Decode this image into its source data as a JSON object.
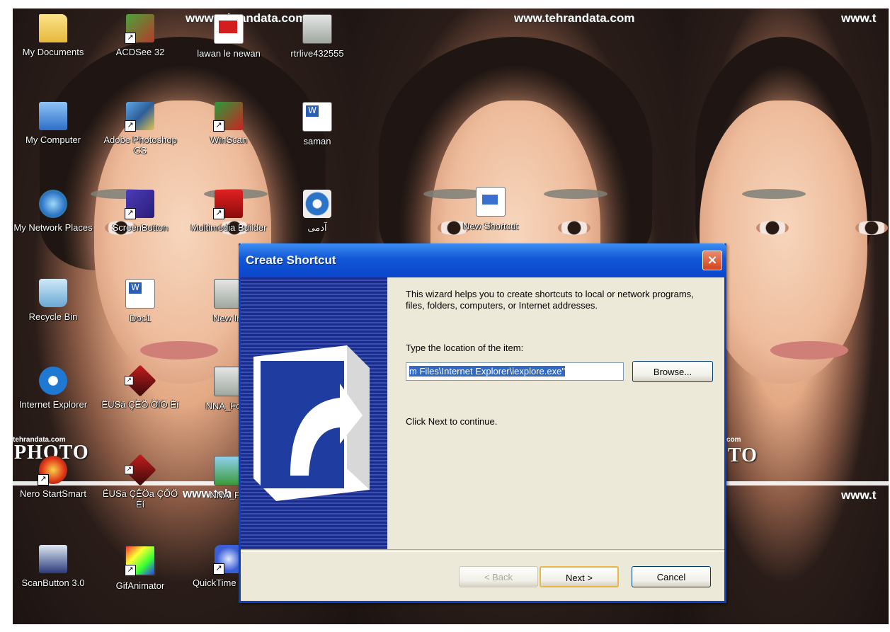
{
  "wallpaper": {
    "urls": [
      "www.tehrandata.com",
      "www.tehrandata.com",
      "www.t",
      "www.teh",
      "www.t"
    ],
    "site_label": "tehrandata.com",
    "photo_text": "PHOTO",
    "photo_text_right": "TO",
    "site_label_right": "com"
  },
  "desktop_icons": [
    {
      "id": "my-documents",
      "label": "My Documents",
      "icon": "folder-icon"
    },
    {
      "id": "acdsee",
      "label": "ACDSee 32",
      "icon": "acdsee-icon"
    },
    {
      "id": "lawan",
      "label": "lawan le newan",
      "icon": "pdf-icon"
    },
    {
      "id": "rtrlive",
      "label": "rtrlive432555",
      "icon": "image-file-icon"
    },
    {
      "id": "my-computer",
      "label": "My Computer",
      "icon": "computer-icon"
    },
    {
      "id": "photoshop",
      "label": "Adobe Photoshop CS",
      "icon": "photoshop-icon"
    },
    {
      "id": "winscan",
      "label": "WinScan",
      "icon": "scanner-icon"
    },
    {
      "id": "saman",
      "label": "saman",
      "icon": "word-doc-icon"
    },
    {
      "id": "my-network",
      "label": "My Network Places",
      "icon": "network-icon"
    },
    {
      "id": "screenbutton",
      "label": "ScreenButton",
      "icon": "app-icon"
    },
    {
      "id": "multimedia",
      "label": "Multimedia Builder",
      "icon": "multimedia-icon"
    },
    {
      "id": "adamy",
      "label": "آدمی",
      "icon": "media-player-icon"
    },
    {
      "id": "recycle-bin",
      "label": "Recycle Bin",
      "icon": "recycle-bin-icon"
    },
    {
      "id": "doc1",
      "label": "Doc1",
      "icon": "word-doc-icon"
    },
    {
      "id": "new-image",
      "label": "New Im",
      "icon": "image-file-icon"
    },
    {
      "id": "internet-explorer",
      "label": "Internet Explorer",
      "icon": "ie-icon"
    },
    {
      "id": "eusa-1",
      "label": "ËUSä ÇÊÖ ÕÌÖ Éí",
      "icon": "app-icon"
    },
    {
      "id": "nna-form",
      "label": "NNA_Form",
      "icon": "image-file-icon"
    },
    {
      "id": "nero",
      "label": "Nero StartSmart",
      "icon": "nero-icon"
    },
    {
      "id": "eusa-2",
      "label": "ËUSä ÇÊÖa ÇÕÖ Éí",
      "icon": "app-icon"
    },
    {
      "id": "nna-pol",
      "label": "NNA_Pol",
      "icon": "image-file-icon"
    },
    {
      "id": "scanbutton",
      "label": "ScanButton 3.0",
      "icon": "scanbutton-icon"
    },
    {
      "id": "gif-animator",
      "label": "GifAnimator",
      "icon": "gif-animator-icon"
    },
    {
      "id": "quicktime",
      "label": "QuickTime Player",
      "icon": "quicktime-icon"
    },
    {
      "id": "new-shortcut",
      "label": "New Shortcut",
      "icon": "new-shortcut-icon"
    }
  ],
  "dialog": {
    "title": "Create Shortcut",
    "close_label": "×",
    "intro": "This wizard helps you to create shortcuts to local or network programs, files, folders, computers, or Internet addresses.",
    "location_label": "Type the location of the item:",
    "location_value": "m Files\\Internet Explorer\\iexplore.exe\"",
    "browse_label": "Browse...",
    "continue_text": "Click Next to continue.",
    "back_label": "< Back",
    "next_label": "Next >",
    "cancel_label": "Cancel"
  },
  "colors": {
    "titlebar": "#0b48cd",
    "dialog_bg": "#ece9d8",
    "selection": "#316ac5",
    "wizard_art": "#1a2c8c"
  }
}
